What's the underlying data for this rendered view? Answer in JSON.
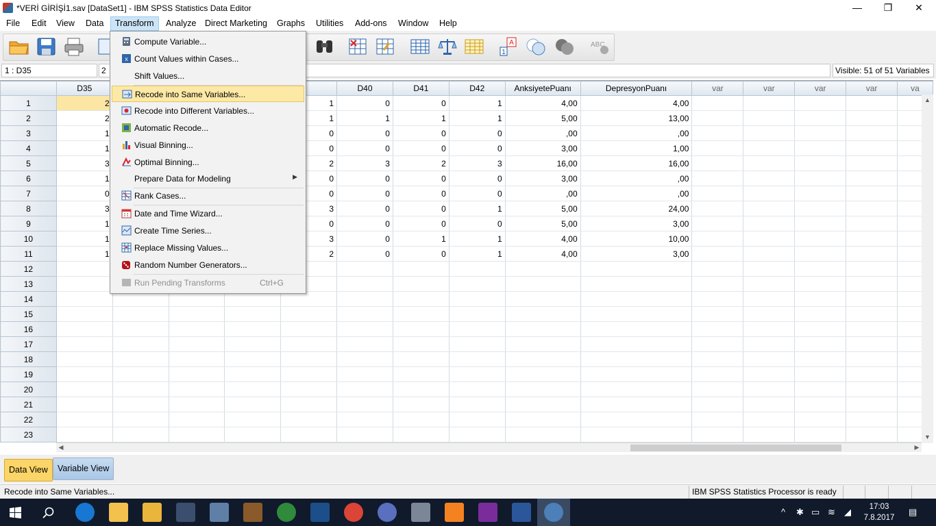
{
  "window": {
    "title": "*VERİ GİRİŞİ1.sav [DataSet1] - IBM SPSS Statistics Data Editor",
    "minimize": "—",
    "maximize": "❐",
    "close": "✕"
  },
  "menubar": [
    "File",
    "Edit",
    "View",
    "Data",
    "Transform",
    "Analyze",
    "Direct Marketing",
    "Graphs",
    "Utilities",
    "Add-ons",
    "Window",
    "Help"
  ],
  "cellbar": {
    "ref": "1 : D35",
    "value": "2",
    "visible": "Visible: 51 of 51 Variables"
  },
  "grid": {
    "columns": [
      "D35",
      "",
      "",
      "",
      "39",
      "D40",
      "D41",
      "D42",
      "AnksiyetePuanı",
      "DepresyonPuanı",
      "var",
      "var",
      "var",
      "var",
      "va"
    ],
    "rows": [
      {
        "n": "1",
        "d35": "2",
        "d39": "1",
        "d40": "0",
        "d41": "0",
        "d42": "1",
        "ank": "4,00",
        "dep": "4,00"
      },
      {
        "n": "2",
        "d35": "2",
        "d39": "1",
        "d40": "1",
        "d41": "1",
        "d42": "1",
        "ank": "5,00",
        "dep": "13,00"
      },
      {
        "n": "3",
        "d35": "1",
        "d39": "0",
        "d40": "0",
        "d41": "0",
        "d42": "0",
        "ank": ",00",
        "dep": ",00"
      },
      {
        "n": "4",
        "d35": "1",
        "d39": "0",
        "d40": "0",
        "d41": "0",
        "d42": "0",
        "ank": "3,00",
        "dep": "1,00"
      },
      {
        "n": "5",
        "d35": "3",
        "d39": "2",
        "d40": "3",
        "d41": "2",
        "d42": "3",
        "ank": "16,00",
        "dep": "16,00"
      },
      {
        "n": "6",
        "d35": "1",
        "d39": "0",
        "d40": "0",
        "d41": "0",
        "d42": "0",
        "ank": "3,00",
        "dep": ",00"
      },
      {
        "n": "7",
        "d35": "0",
        "d39": "0",
        "d40": "0",
        "d41": "0",
        "d42": "0",
        "ank": ",00",
        "dep": ",00"
      },
      {
        "n": "8",
        "d35": "3",
        "d39": "3",
        "d40": "0",
        "d41": "0",
        "d42": "1",
        "ank": "5,00",
        "dep": "24,00"
      },
      {
        "n": "9",
        "d35": "1",
        "d39": "0",
        "d40": "0",
        "d41": "0",
        "d42": "0",
        "ank": "5,00",
        "dep": "3,00"
      },
      {
        "n": "10",
        "d35": "1",
        "d39": "3",
        "d40": "0",
        "d41": "1",
        "d42": "1",
        "ank": "4,00",
        "dep": "10,00"
      },
      {
        "n": "11",
        "d35": "1",
        "d39": "2",
        "d40": "0",
        "d41": "0",
        "d42": "1",
        "ank": "4,00",
        "dep": "3,00"
      },
      {
        "n": "12"
      },
      {
        "n": "13"
      },
      {
        "n": "14"
      },
      {
        "n": "15"
      },
      {
        "n": "16"
      },
      {
        "n": "17"
      },
      {
        "n": "18"
      },
      {
        "n": "19"
      },
      {
        "n": "20"
      },
      {
        "n": "21"
      },
      {
        "n": "22"
      },
      {
        "n": "23"
      }
    ]
  },
  "transform_menu": {
    "items": [
      {
        "label": "Compute Variable...",
        "icon": "compute-icon"
      },
      {
        "label": "Count Values within Cases...",
        "icon": "count-icon"
      },
      {
        "label": "Shift Values...",
        "icon": ""
      },
      {
        "label": "Recode into Same Variables...",
        "icon": "recode-same-icon",
        "highlighted": true
      },
      {
        "label": "Recode into Different Variables...",
        "icon": "recode-different-icon"
      },
      {
        "label": "Automatic Recode...",
        "icon": "automatic-recode-icon"
      },
      {
        "label": "Visual Binning...",
        "icon": "visual-binning-icon"
      },
      {
        "label": "Optimal Binning...",
        "icon": "optimal-binning-icon"
      },
      {
        "label": "Prepare Data for Modeling",
        "icon": "",
        "submenu": "▶"
      },
      {
        "label": "Rank Cases...",
        "icon": "rank-cases-icon"
      },
      {
        "label": "Date and Time Wizard...",
        "icon": "date-time-icon"
      },
      {
        "label": "Create Time Series...",
        "icon": "time-series-icon"
      },
      {
        "label": "Replace Missing Values...",
        "icon": "replace-missing-icon"
      },
      {
        "label": "Random Number Generators...",
        "icon": "random-dice-icon"
      },
      {
        "label": "Run Pending Transforms",
        "icon": "run-pending-icon",
        "shortcut": "Ctrl+G",
        "disabled": true
      }
    ]
  },
  "tabs": {
    "data_view": "Data View",
    "variable_view": "Variable View"
  },
  "status": {
    "message": "Recode into Same Variables...",
    "processor": "IBM SPSS Statistics Processor is ready"
  },
  "taskbar": {
    "time": "17:03",
    "date": "7.8.2017"
  },
  "colors": {
    "highlight": "#fce9a6",
    "selected_cell": "#fce6a4",
    "data_view_tab": "#fbd567",
    "taskbar": "#101a2b"
  }
}
